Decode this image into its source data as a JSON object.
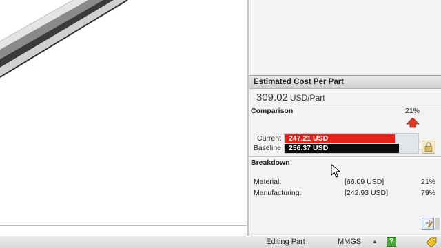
{
  "cost_panel": {
    "header": "Estimated Cost Per Part",
    "value": "309.02",
    "unit": "USD/Part",
    "comparison": {
      "label": "Comparison",
      "percent": "21%",
      "current": {
        "label": "Current",
        "value_text": "247.21 USD",
        "amount": 247.21,
        "color": "#e8221b"
      },
      "baseline": {
        "label": "Baseline",
        "value_text": "256.37 USD",
        "amount": 256.37,
        "color": "#0a0a0a"
      }
    },
    "breakdown": {
      "label": "Breakdown",
      "rows": [
        {
          "label": "Material:",
          "value": "[66.09 USD]",
          "percent": "21%"
        },
        {
          "label": "Manufacturing:",
          "value": "[242.93 USD]",
          "percent": "79%"
        }
      ]
    },
    "icons": {
      "trend": "up-arrow-icon",
      "lock": "lock-icon",
      "action": "edit-report-icon"
    }
  },
  "status_bar": {
    "status": "Editing Part",
    "units": "MMGS",
    "units_caret": "▲",
    "help_glyph": "?",
    "icons": [
      "help-icon",
      "tag-icon"
    ]
  }
}
